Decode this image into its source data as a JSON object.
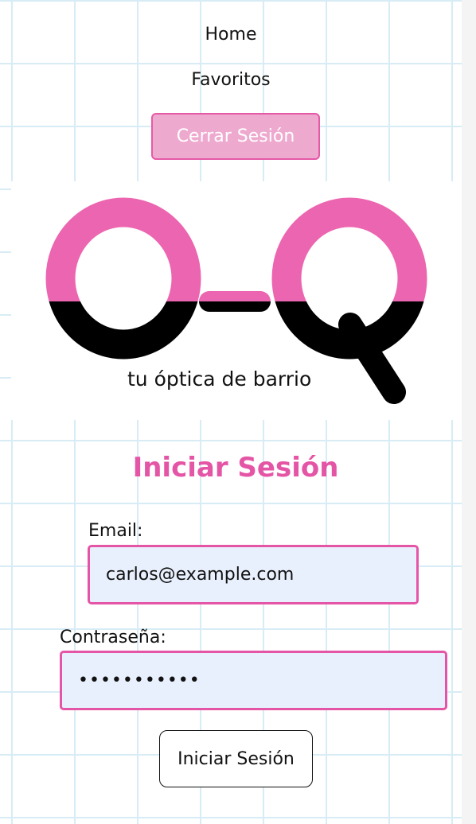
{
  "nav": {
    "home_label": "Home",
    "favorites_label": "Favoritos",
    "logout_label": "Cerrar Sesión"
  },
  "logo": {
    "left_letter": "O",
    "right_letter": "Q",
    "tagline": "tu óptica de barrio",
    "colors": {
      "top": "#ec65b0",
      "bottom": "#000000"
    }
  },
  "login": {
    "title": "Iniciar Sesión",
    "email_label": "Email:",
    "email_value": "carlos@example.com",
    "password_label": "Contraseña:",
    "password_value": "•••••••••••",
    "submit_label": "Iniciar Sesión"
  },
  "colors": {
    "accent": "#e555a6",
    "accent_light": "#eea9cf",
    "input_bg": "#e9f0fd",
    "grid": "#d7ecf5"
  }
}
